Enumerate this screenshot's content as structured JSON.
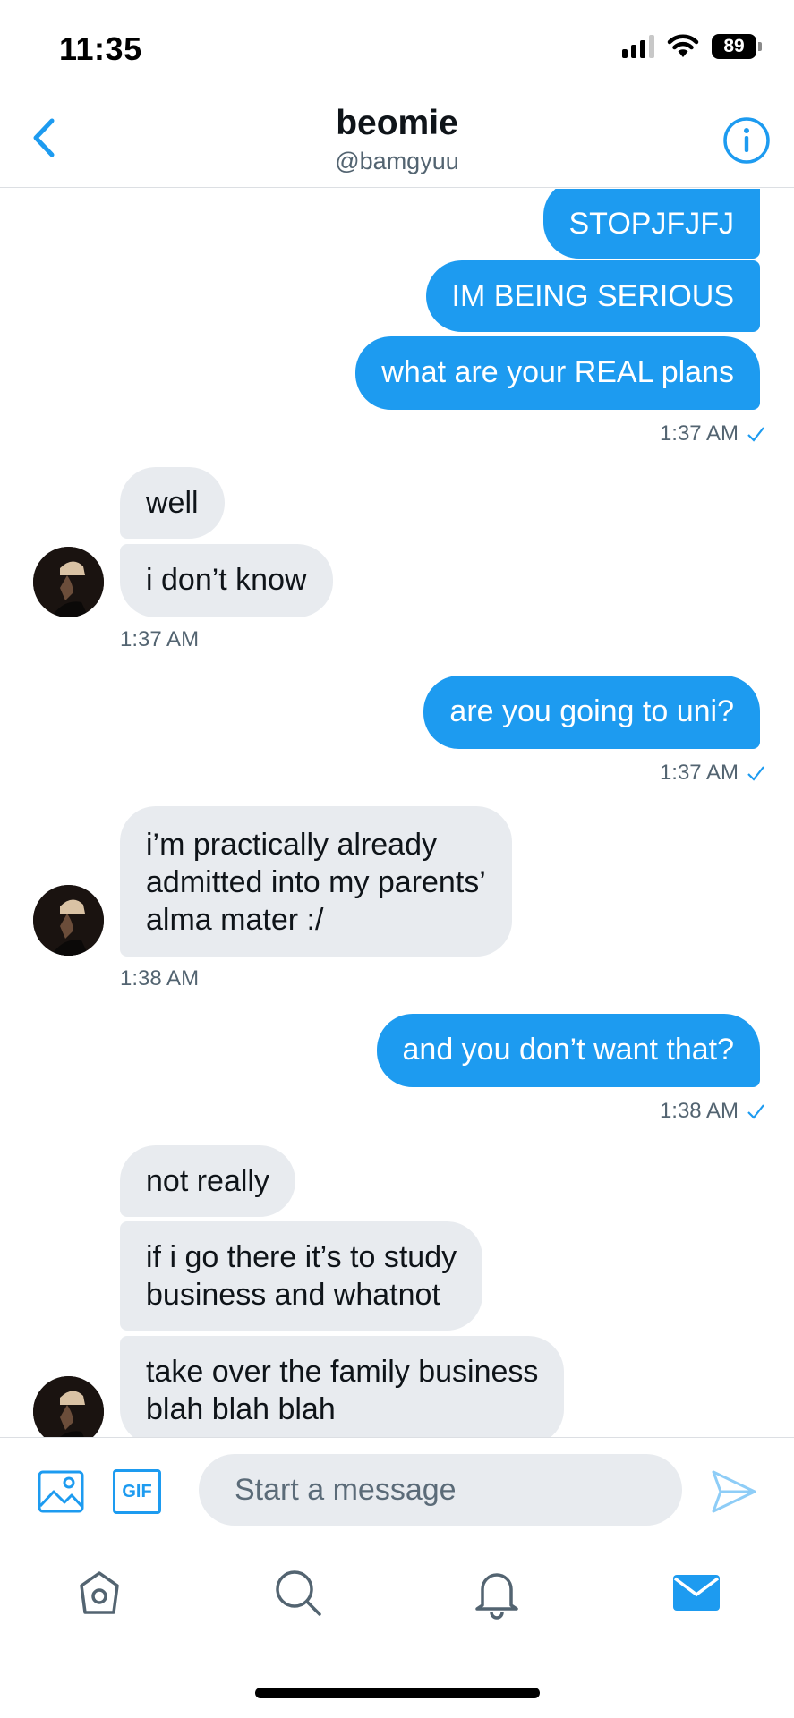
{
  "status_bar": {
    "time": "11:35",
    "battery": "89"
  },
  "header": {
    "title": "beomie",
    "handle": "@bamgyuu",
    "back_icon": "chevron-left-icon",
    "info_icon": "info-circle-icon"
  },
  "messages": {
    "m1": "STOPJFJFJ",
    "m2": "IM BEING SERIOUS",
    "m3": "what are your REAL plans",
    "ts1": "1:37 AM",
    "m4": "well",
    "m5": "i don’t know",
    "ts2": "1:37 AM",
    "m6": "are you going to uni?",
    "ts3": "1:37 AM",
    "m7_line1": "i’m practically already",
    "m7_line2": "admitted into my parents’",
    "m7_line3": "alma mater :/",
    "ts4": "1:38 AM",
    "m8": "and you don’t want that?",
    "ts5": "1:38 AM",
    "m9": "not really",
    "m10_line1": "if i go there it’s to study",
    "m10_line2": "business and whatnot",
    "m11_line1": "take over the family business",
    "m11_line2": "blah blah blah"
  },
  "composer": {
    "placeholder": "Start a message",
    "gif_label": "GIF"
  },
  "nav": {
    "items": [
      "home-icon",
      "search-icon",
      "bell-icon",
      "mail-icon"
    ]
  },
  "colors": {
    "accent": "#1d9bf0",
    "incoming_bubble": "#e8ebef",
    "muted_text": "#536471"
  }
}
